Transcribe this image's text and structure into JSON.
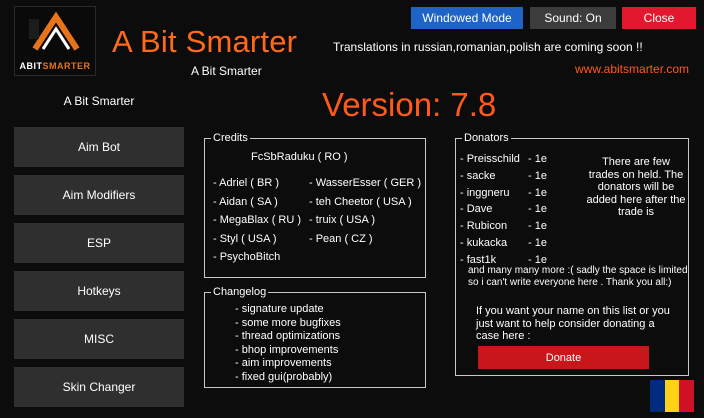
{
  "app": {
    "title": "A Bit Smarter",
    "subtitle": "A Bit Smarter",
    "announcement": "Translations in russian,romanian,polish are coming soon !!",
    "website": "www.abitsmarter.com",
    "version": "Version: 7.8",
    "logo": {
      "text_main": "ABIT",
      "text_accent": "SMARTER"
    }
  },
  "top_buttons": {
    "windowed": "Windowed Mode",
    "sound": "Sound: On",
    "close": "Close"
  },
  "sidebar": {
    "header": "A Bit Smarter",
    "items": [
      {
        "label": "Aim Bot"
      },
      {
        "label": "Aim Modifiers"
      },
      {
        "label": "ESP"
      },
      {
        "label": "Hotkeys"
      },
      {
        "label": "MISC"
      },
      {
        "label": "Skin Changer"
      }
    ]
  },
  "credits": {
    "title": "Credits",
    "lead": "FcSbRaduku ( RO )",
    "col_a": [
      "- Adriel ( BR )",
      "- Aidan ( SA )",
      "- MegaBlax ( RU )",
      "- Styl ( USA )",
      "- PsychoBitch"
    ],
    "col_b": [
      "- WasserEsser ( GER )",
      "- teh Cheetor ( USA )",
      "- truix ( USA )",
      "- Pean ( CZ )"
    ]
  },
  "changelog": {
    "title": "Changelog",
    "items": [
      "-  signature update",
      "-  some more bugfixes",
      "-  thread optimizations",
      "-  bhop improvements",
      "-  aim improvements",
      "-  fixed gui(probably)"
    ]
  },
  "donators": {
    "title": "Donators",
    "list": [
      {
        "name": "-  Preisschild",
        "amount": "- 1e"
      },
      {
        "name": "-  sacke",
        "amount": "- 1e"
      },
      {
        "name": "-  inggneru",
        "amount": "- 1e"
      },
      {
        "name": "-  Dave",
        "amount": "- 1e"
      },
      {
        "name": "- Rubicon",
        "amount": "- 1e"
      },
      {
        "name": "- kukacka",
        "amount": "- 1e"
      },
      {
        "name": "- fast1k",
        "amount": "- 1e"
      }
    ],
    "note": "There are few trades on held. The donators will be added here after the trade is",
    "more": "and many many more :( sadly the space is limited so i can't write everyone here . Thank you all:)",
    "cta": "If you want your name on this list or you just want to help consider donating a case here :",
    "donate_button": "Donate"
  },
  "colors": {
    "accent": "#ff5a1a",
    "windowed_button": "#1d63c8",
    "sound_button": "#3c3c3c",
    "close_button": "#e2182e",
    "donate_button": "#c8161a",
    "flag": [
      "#002b7f",
      "#fcd116",
      "#ce1126"
    ]
  }
}
